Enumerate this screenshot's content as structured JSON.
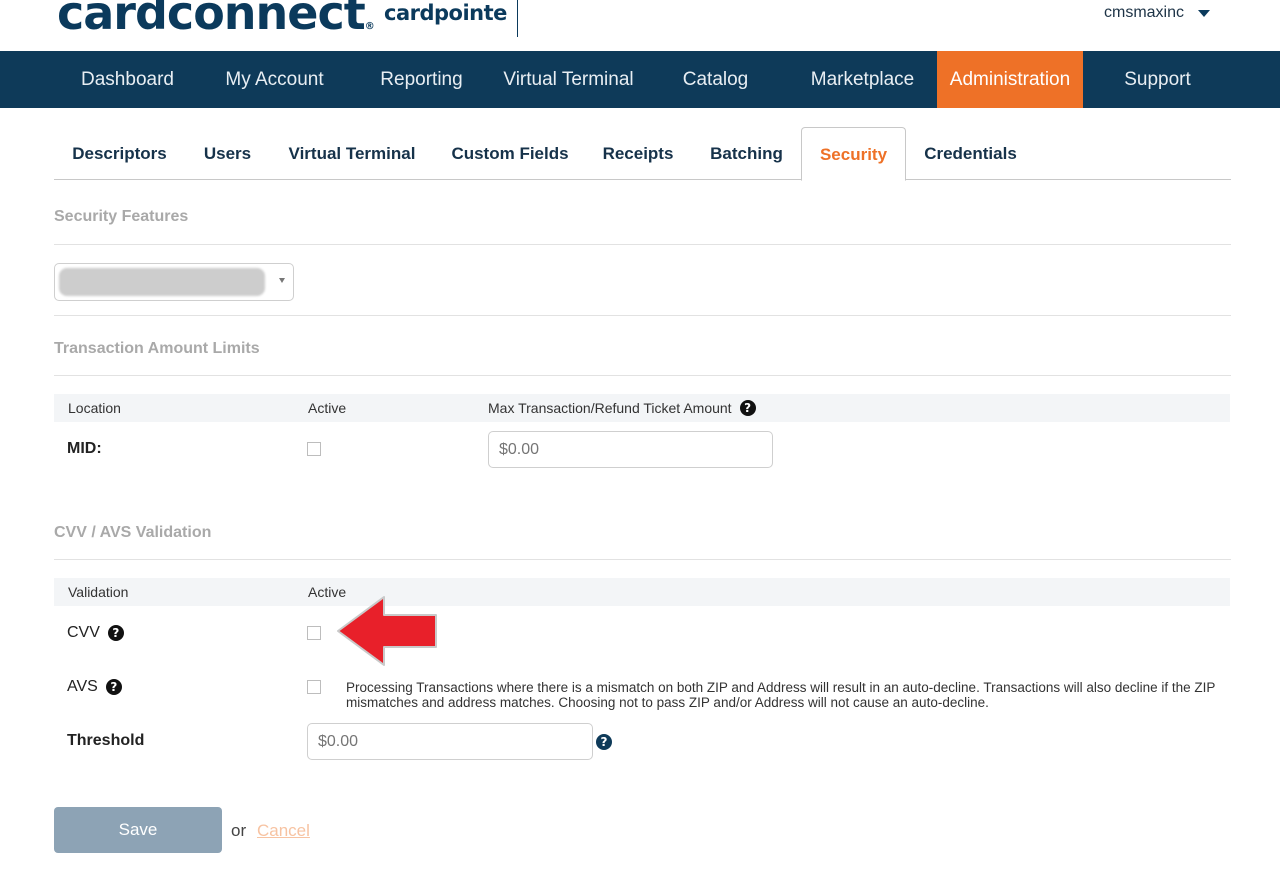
{
  "brand": {
    "logo_main": "cardconnect",
    "logo_reg": "®",
    "logo_sub": "cardpointe"
  },
  "user": {
    "name": "cmsmaxinc"
  },
  "nav": {
    "items": [
      {
        "label": "Dashboard",
        "active": false
      },
      {
        "label": "My Account",
        "active": false
      },
      {
        "label": "Reporting",
        "active": false
      },
      {
        "label": "Virtual Terminal",
        "active": false
      },
      {
        "label": "Catalog",
        "active": false
      },
      {
        "label": "Marketplace",
        "active": false
      },
      {
        "label": "Administration",
        "active": true
      },
      {
        "label": "Support",
        "active": false
      }
    ]
  },
  "tabs": {
    "items": [
      {
        "label": "Descriptors"
      },
      {
        "label": "Users"
      },
      {
        "label": "Virtual Terminal"
      },
      {
        "label": "Custom Fields"
      },
      {
        "label": "Receipts"
      },
      {
        "label": "Batching"
      },
      {
        "label": "Security"
      },
      {
        "label": "Credentials"
      }
    ],
    "active": "Security"
  },
  "security_features": {
    "title": "Security Features"
  },
  "amount_limits": {
    "title": "Transaction Amount Limits",
    "headers": {
      "location": "Location",
      "active": "Active",
      "max": "Max Transaction/Refund Ticket Amount"
    },
    "row": {
      "label": "MID:",
      "placeholder": "$0.00"
    }
  },
  "validation": {
    "title": "CVV / AVS Validation",
    "headers": {
      "validation": "Validation",
      "active": "Active"
    },
    "cvv_label": "CVV",
    "avs_label": "AVS",
    "avs_description": "Processing Transactions where there is a mismatch on both ZIP and Address will result in an auto-decline. Transactions will also decline if the ZIP mismatches and address matches. Choosing not to pass ZIP and/or Address will not cause an auto-decline.",
    "threshold_label": "Threshold",
    "threshold_placeholder": "$0.00"
  },
  "help_glyph": "?",
  "actions": {
    "save": "Save",
    "or": "or",
    "cancel": "Cancel"
  },
  "colors": {
    "nav_bg": "#0e3a59",
    "accent": "#ee7127",
    "save_bg": "#8da3b5",
    "annotation_arrow": "#e8202a"
  }
}
